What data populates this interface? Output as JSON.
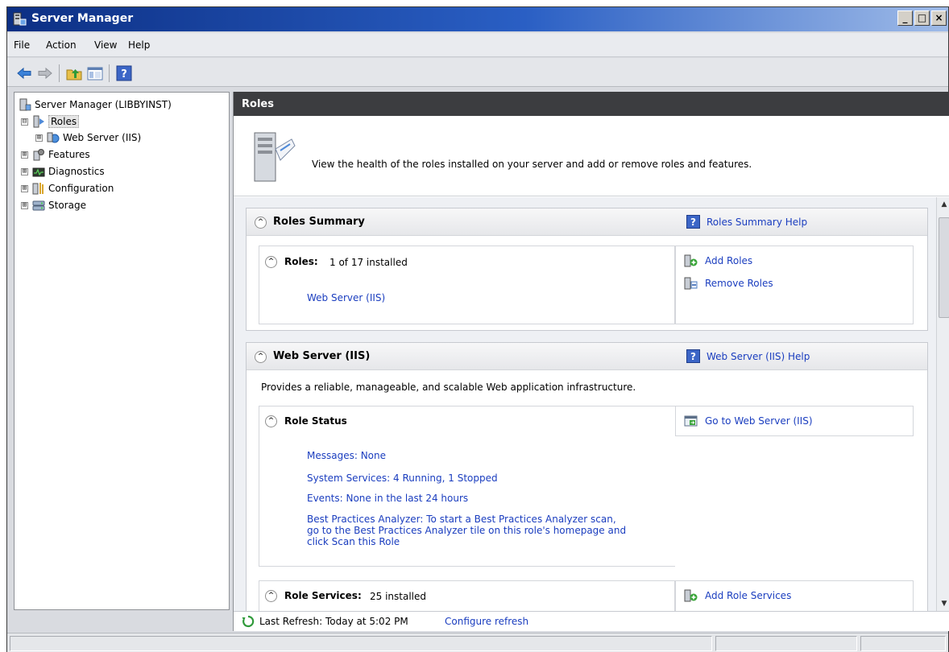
{
  "window": {
    "title": "Server Manager",
    "controls": [
      "_",
      "□",
      "×"
    ]
  },
  "menu": [
    "File",
    "Action",
    "View",
    "Help"
  ],
  "toolbar": {
    "buttons": [
      "back-arrow-icon",
      "forward-arrow-icon",
      "up-folder-icon",
      "show-hide-tree-icon",
      "help-icon"
    ]
  },
  "tree": {
    "root": "Server Manager (LIBBYINST)",
    "items": [
      {
        "label": "Roles",
        "expander": "⊟",
        "icon": "roles-icon"
      },
      {
        "label": "Web Server (IIS)",
        "expander": "⊞",
        "icon": "web-server-icon"
      },
      {
        "label": "Features",
        "expander": "⊞",
        "icon": "features-icon"
      },
      {
        "label": "Diagnostics",
        "expander": "⊞",
        "icon": "diagnostics-icon"
      },
      {
        "label": "Configuration",
        "expander": "⊞",
        "icon": "configuration-icon"
      },
      {
        "label": "Storage",
        "expander": "⊞",
        "icon": "storage-icon"
      }
    ]
  },
  "content": {
    "header": "Roles",
    "intro": "View the health of the roles installed on your server and add or remove roles and features.",
    "roles_summary": {
      "title": "Roles Summary",
      "help": "Roles Summary Help",
      "roles_label": "Roles:",
      "roles_count": "1 of 17 installed",
      "installed_role": "Web Server (IIS)",
      "add_roles": "Add Roles",
      "remove_roles": "Remove Roles"
    },
    "web_server": {
      "title": "Web Server (IIS)",
      "help": "Web Server (IIS) Help",
      "description": "Provides a reliable, manageable, and scalable Web application infrastructure.",
      "role_status": "Role Status",
      "go_to": "Go to Web Server (IIS)",
      "messages": "Messages: None",
      "services": "System Services: 4 Running, 1 Stopped",
      "events": "Events: None in the last 24 hours",
      "bpa_line1": "Best Practices Analyzer: To start a Best Practices Analyzer scan,",
      "bpa_line2": "go to the Best Practices Analyzer tile on this role's homepage and",
      "bpa_line3": "click Scan this Role",
      "role_services_label": "Role Services:",
      "role_services_count": "25 installed",
      "add_role_services": "Add Role Services"
    },
    "refresh": {
      "last_refresh": "Last Refresh: Today at 5:02 PM",
      "configure": "Configure refresh"
    }
  },
  "colors": {
    "link": "#1a3dbf",
    "titlebar": "#0c2f84",
    "header": "#3c3d40"
  }
}
